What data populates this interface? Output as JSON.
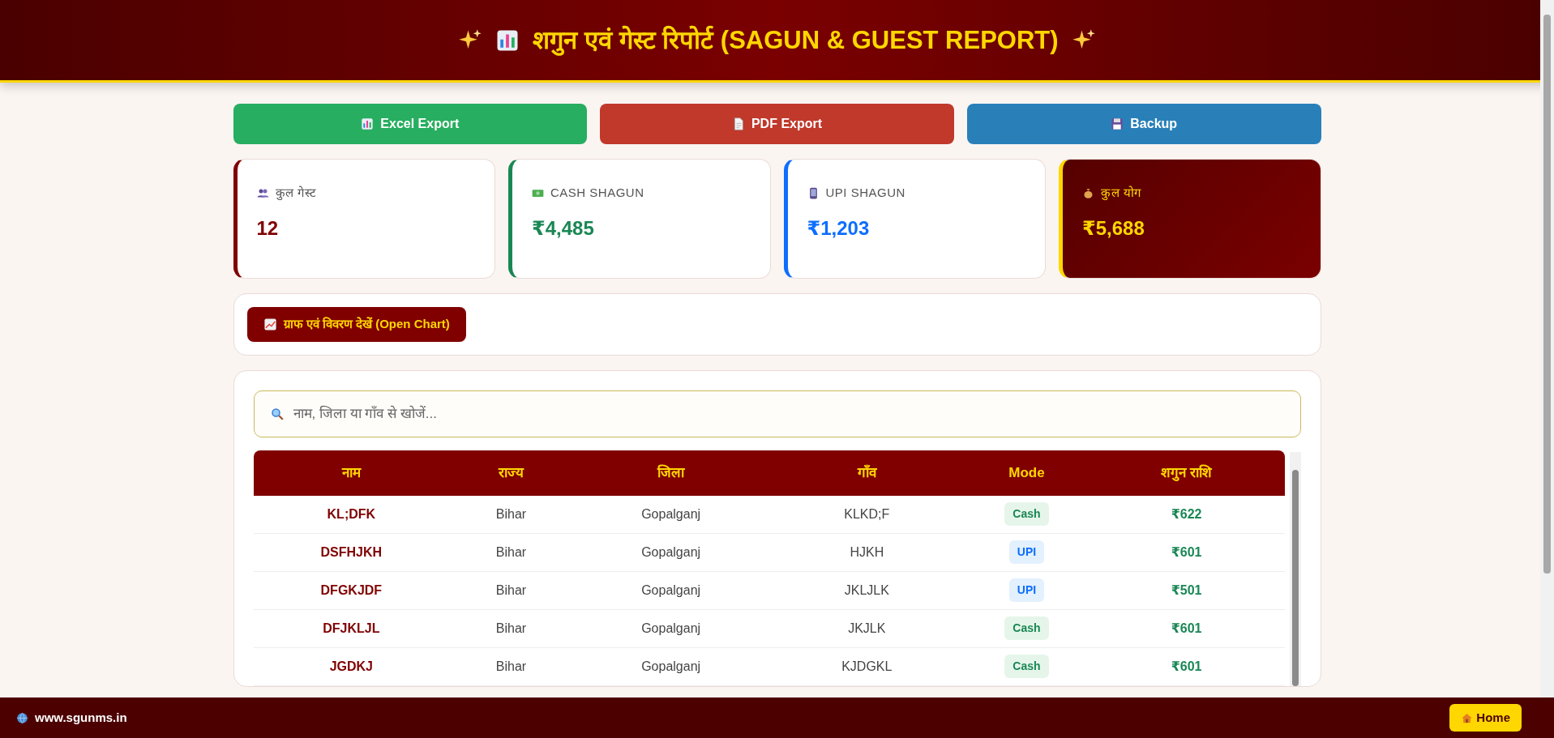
{
  "header": {
    "title": "शगुन एवं गेस्ट रिपोर्ट (SAGUN & GUEST REPORT)"
  },
  "actions": [
    {
      "label": "Excel Export",
      "kind": "excel"
    },
    {
      "label": "PDF Export",
      "kind": "pdf"
    },
    {
      "label": "Backup",
      "kind": "backup"
    }
  ],
  "stats": [
    {
      "label": "कुल गेस्ट",
      "value": "12",
      "kind": "plain",
      "color": "#800000"
    },
    {
      "label": "CASH SHAGUN",
      "value": "₹4,485",
      "kind": "plain",
      "color": "#198754"
    },
    {
      "label": "UPI SHAGUN",
      "value": "₹1,203",
      "kind": "plain",
      "color": "#0d6efd"
    },
    {
      "label": "कुल योग",
      "value": "₹5,688",
      "kind": "highlight",
      "color": "#ffd700"
    }
  ],
  "chart_button": {
    "label": "ग्राफ एवं विवरण देखें (Open Chart)"
  },
  "search": {
    "placeholder": "नाम, जिला या गाँव से खोजें..."
  },
  "table": {
    "columns": [
      "नाम",
      "राज्य",
      "जिला",
      "गाँव",
      "Mode",
      "शगुन राशि"
    ],
    "rows": [
      {
        "name": "KL;DFK",
        "state": "Bihar",
        "district": "Gopalganj",
        "village": "KLKD;F",
        "mode": {
          "label": "Cash",
          "kind": "cash"
        },
        "amount": "₹622"
      },
      {
        "name": "DSFHJKH",
        "state": "Bihar",
        "district": "Gopalganj",
        "village": "HJKH",
        "mode": {
          "label": "UPI",
          "kind": "upi"
        },
        "amount": "₹601"
      },
      {
        "name": "DFGKJDF",
        "state": "Bihar",
        "district": "Gopalganj",
        "village": "JKLJLK",
        "mode": {
          "label": "UPI",
          "kind": "upi"
        },
        "amount": "₹501"
      },
      {
        "name": "DFJKLJL",
        "state": "Bihar",
        "district": "Gopalganj",
        "village": "JKJLK",
        "mode": {
          "label": "Cash",
          "kind": "cash"
        },
        "amount": "₹601"
      },
      {
        "name": "JGDKJ",
        "state": "Bihar",
        "district": "Gopalganj",
        "village": "KJDGKL",
        "mode": {
          "label": "Cash",
          "kind": "cash"
        },
        "amount": "₹601"
      }
    ]
  },
  "footer": {
    "site": "www.sgunms.in",
    "home_button": "Home"
  }
}
